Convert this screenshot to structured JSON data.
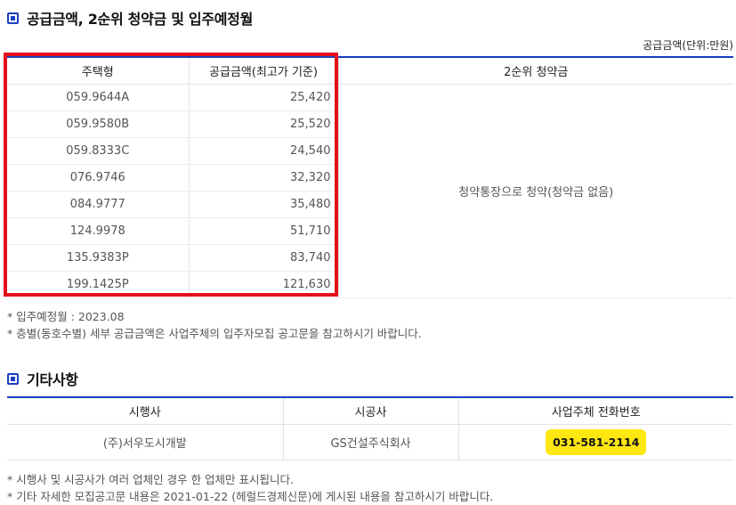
{
  "supply_section": {
    "title": "공급금액, 2순위 청약금 및 입주예정월",
    "unit": "공급금액(단위:만원)",
    "headers": [
      "주택형",
      "공급금액(최고가 기준)",
      "2순위 청약금"
    ],
    "rows": [
      {
        "type": "059.9644A",
        "amount": "25,420"
      },
      {
        "type": "059.9580B",
        "amount": "25,520"
      },
      {
        "type": "059.8333C",
        "amount": "24,540"
      },
      {
        "type": "076.9746",
        "amount": "32,320"
      },
      {
        "type": "084.9777",
        "amount": "35,480"
      },
      {
        "type": "124.9978",
        "amount": "51,710"
      },
      {
        "type": "135.9383P",
        "amount": "83,740"
      },
      {
        "type": "199.1425P",
        "amount": "121,630"
      }
    ],
    "deposit": "청약통장으로 청약(청약금 없음)",
    "notes": [
      "* 입주예정월 : 2023.08",
      "* 층별(동호수별) 세부 공급금액은 사업주체의 입주자모집 공고문을 참고하시기 바랍니다."
    ]
  },
  "etc_section": {
    "title": "기타사항",
    "headers": [
      "시행사",
      "시공사",
      "사업주체 전화번호"
    ],
    "developer": "(주)서우도시개발",
    "builder": "GS건설주식회사",
    "phone": "031-581-2114",
    "notes": [
      "* 시행사 및 시공사가 여러 업체인 경우 한 업체만 표시됩니다.",
      "* 기타 자세한 모집공고문 내용은 2021-01-22 (헤럴드경제신문)에 게시된 내용을 참고하시기 바랍니다."
    ]
  },
  "colors": {
    "accent": "#1a3fc0",
    "highlight": "#e3111c",
    "phone_bg": "#ffe712"
  }
}
